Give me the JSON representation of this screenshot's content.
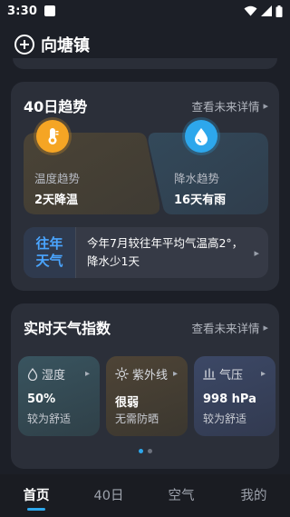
{
  "status_bar": {
    "time": "3:30"
  },
  "header": {
    "city": "向塘镇"
  },
  "trend_card": {
    "title": "40日趋势",
    "more_label": "查看未来详情",
    "temp": {
      "label": "温度趋势",
      "value": "2天降温",
      "icon": "thermometer-icon",
      "color": "#f5a524"
    },
    "rain": {
      "label": "降水趋势",
      "value": "16天有雨",
      "icon": "raindrop-icon",
      "color": "#2da7ec"
    },
    "history": {
      "badge_line1": "往年",
      "badge_line2": "天气",
      "text": "今年7月较往年平均气温高2°，降水少1天"
    }
  },
  "index_card": {
    "title": "实时天气指数",
    "more_label": "查看未来详情",
    "items": [
      {
        "name": "湿度",
        "value": "50%",
        "desc": "较为舒适",
        "icon": "humidity-drop-icon"
      },
      {
        "name": "紫外线",
        "value": "很弱",
        "desc": "无需防晒",
        "icon": "sun-icon"
      },
      {
        "name": "气压",
        "value": "998 hPa",
        "desc": "较为舒适",
        "icon": "pressure-icon"
      }
    ],
    "page_count": 2,
    "active_page": 1
  },
  "bottom_nav": {
    "tabs": [
      {
        "label": "首页",
        "active": true
      },
      {
        "label": "40日",
        "active": false
      },
      {
        "label": "空气",
        "active": false
      },
      {
        "label": "我的",
        "active": false
      }
    ]
  }
}
